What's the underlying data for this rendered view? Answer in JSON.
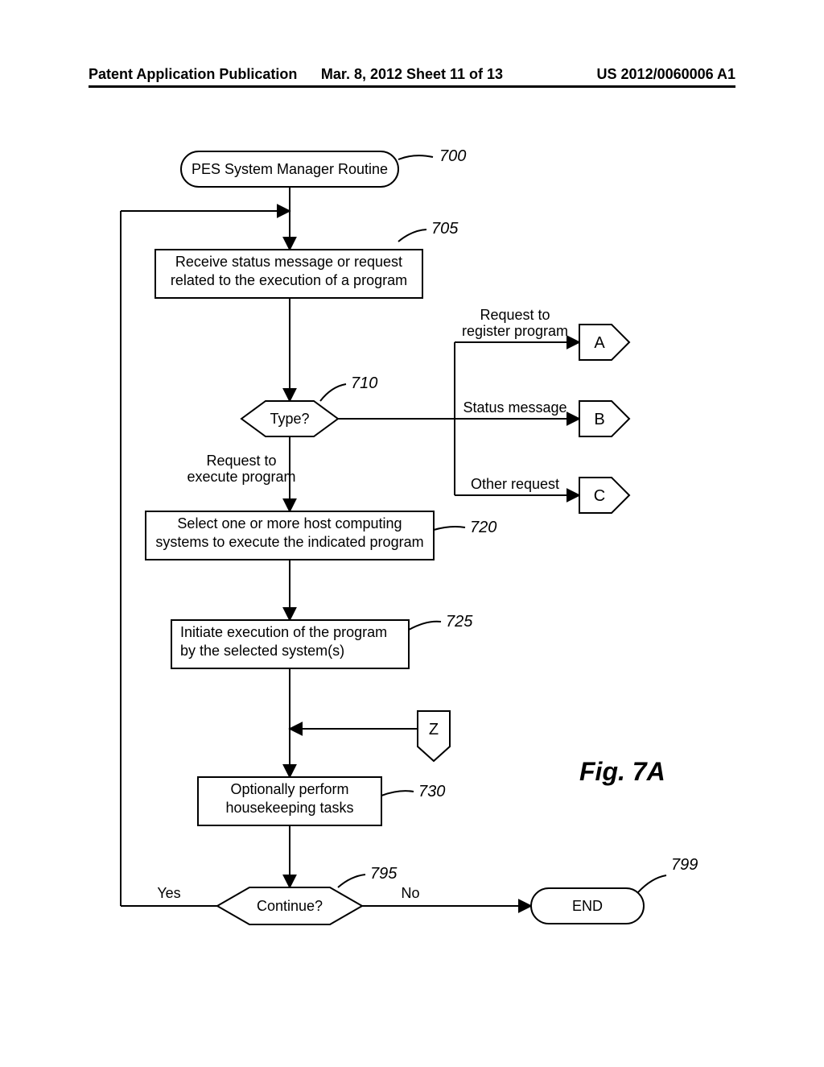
{
  "header": {
    "left": "Patent Application Publication",
    "mid": "Mar. 8, 2012  Sheet 11 of 13",
    "right": "US 2012/0060006 A1"
  },
  "terminal700": "PES System Manager Routine",
  "ref700": "700",
  "box705": "Receive status message or request related to the execution of a program",
  "ref705": "705",
  "dec710": "Type?",
  "ref710": "710",
  "lbl_register1": "Request to",
  "lbl_register2": "register program",
  "lbl_status": "Status message",
  "lbl_request_exec1": "Request to",
  "lbl_request_exec2": "execute program",
  "lbl_other": "Other request",
  "connA": "A",
  "connB": "B",
  "connC": "C",
  "connZ": "Z",
  "box720": "Select one or more host computing systems to execute the indicated program",
  "ref720": "720",
  "box725": "Initiate execution of the program by the selected system(s)",
  "ref725": "725",
  "box730": "Optionally perform housekeeping tasks",
  "ref730": "730",
  "dec795": "Continue?",
  "ref795": "795",
  "lblYes": "Yes",
  "lblNo": "No",
  "terminal799": "END",
  "ref799": "799",
  "figlabel": "Fig. 7A"
}
